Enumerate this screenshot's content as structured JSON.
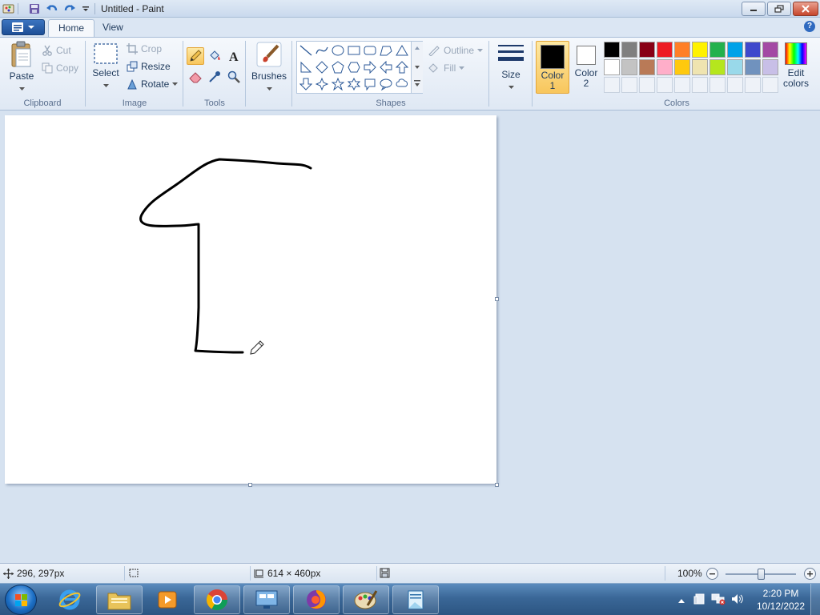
{
  "window": {
    "title": "Untitled - Paint"
  },
  "tabs": [
    {
      "label": "Home",
      "active": true
    },
    {
      "label": "View",
      "active": false
    }
  ],
  "ribbon": {
    "clipboard": {
      "label": "Clipboard",
      "paste": "Paste",
      "cut": "Cut",
      "copy": "Copy"
    },
    "image": {
      "label": "Image",
      "select": "Select",
      "crop": "Crop",
      "resize": "Resize",
      "rotate": "Rotate"
    },
    "tools": {
      "label": "Tools",
      "items": [
        "pencil-icon",
        "fill-bucket-icon",
        "text-icon",
        "eraser-icon",
        "color-picker-icon",
        "magnifier-icon"
      ],
      "selected": "pencil-icon"
    },
    "brushes": {
      "label": "Brushes"
    },
    "shapes": {
      "label": "Shapes",
      "outline": "Outline",
      "fill": "Fill"
    },
    "size": {
      "label": "Size"
    },
    "colors": {
      "label": "Colors",
      "color1_label": "Color",
      "color1_num": "1",
      "color2_label": "Color",
      "color2_num": "2",
      "color1": "#000000",
      "color2": "#ffffff",
      "edit": "Edit",
      "edit2": "colors",
      "palette_row1": [
        "#000000",
        "#7f7f7f",
        "#880015",
        "#ed1c24",
        "#ff7f27",
        "#fff200",
        "#22b14c",
        "#00a2e8",
        "#3f48cc",
        "#a349a4"
      ],
      "palette_row2": [
        "#ffffff",
        "#c3c3c3",
        "#b97a57",
        "#ffaec9",
        "#ffc90e",
        "#efe4b0",
        "#b5e61d",
        "#99d9ea",
        "#7092be",
        "#c8bfe7"
      ]
    }
  },
  "canvas": {
    "background": "#ffffff",
    "stroke_color": "#000000"
  },
  "statusbar": {
    "cursor_pos": "296, 297px",
    "canvas_size": "614 × 460px",
    "zoom": "100%",
    "zoom_level": 1.0
  },
  "taskbar": {
    "time": "2:20 PM",
    "date": "10/12/2022",
    "apps": [
      "internet-explorer-icon",
      "file-explorer-icon",
      "media-player-icon",
      "chrome-icon",
      "control-panel-icon",
      "firefox-icon",
      "paint-icon",
      "notepad-icon"
    ]
  }
}
